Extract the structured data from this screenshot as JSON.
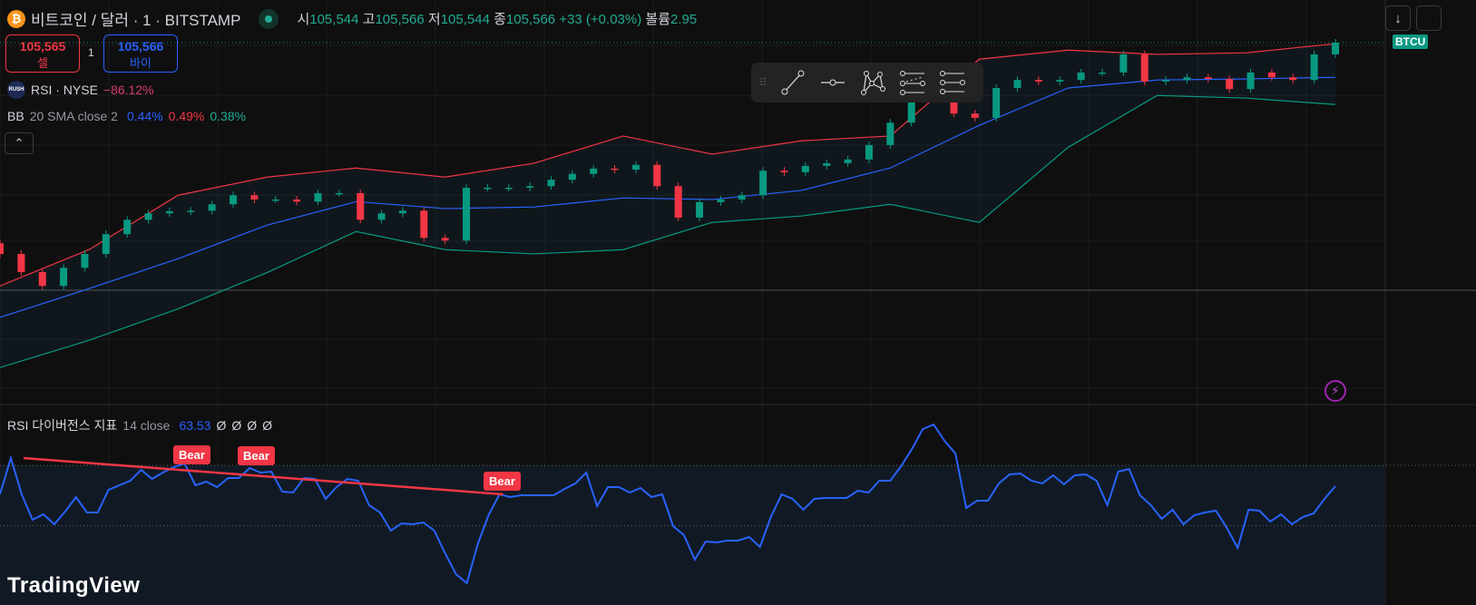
{
  "header": {
    "coin_icon": "₿",
    "symbol_title": "비트코인 / 달러 · 1 · BITSTAMP",
    "ohlc": [
      {
        "label": "시",
        "value": "105,544"
      },
      {
        "label": "고",
        "value": "105,566"
      },
      {
        "label": "저",
        "value": "105,544"
      },
      {
        "label": "종",
        "value": "105,566"
      }
    ],
    "change": "+33 (+0.03%)",
    "volume_label": "볼륨",
    "volume_value": "2.95"
  },
  "trade": {
    "sell_price": "105,565",
    "sell_label": "셀",
    "quantity": "1",
    "buy_price": "105,566",
    "buy_label": "바이"
  },
  "overlay": {
    "badge": "RUSH",
    "name": "RSI · NYSE",
    "value": "−86.12%"
  },
  "bb": {
    "name": "BB",
    "params": "20 SMA close 2",
    "mid": "0.44%",
    "upper": "0.49%",
    "lower": "0.38%"
  },
  "price_label": "BTCU",
  "rsi_pane": {
    "name": "RSI 다이버전스 지표",
    "params": "14 close",
    "value": "63.53",
    "empties": [
      "Ø",
      "Ø",
      "Ø",
      "Ø"
    ],
    "bear_label": "Bear"
  },
  "logo": "TradingView",
  "colors": {
    "up": "#089981",
    "down": "#f23645",
    "bb_upper": "#f23645",
    "bb_mid": "#2962ff",
    "bb_lower": "#089981",
    "rsi": "#2962ff"
  },
  "chart_data": [
    {
      "type": "candlestick",
      "title": "BTCUSD 1m",
      "closes": [
        105170,
        105136,
        105110,
        105144,
        105170,
        105207,
        105234,
        105246,
        105250,
        105251,
        105263,
        105280,
        105272,
        105272,
        105268,
        105284,
        105284,
        105234,
        105246,
        105251,
        105200,
        105195,
        105294,
        105294,
        105294,
        105297,
        105309,
        105320,
        105330,
        105328,
        105337,
        105297,
        105238,
        105267,
        105272,
        105280,
        105326,
        105323,
        105335,
        105340,
        105347,
        105374,
        105416,
        105462,
        105469,
        105433,
        105425,
        105481,
        105496,
        105493,
        105496,
        105510,
        105510,
        105544,
        105493,
        105496,
        105501,
        105498,
        105479,
        105510,
        105501,
        105496,
        105544,
        105566
      ],
      "bb_upper": [
        105110,
        105178,
        105280,
        105314,
        105331,
        105314,
        105340,
        105391,
        105357,
        105382,
        105391,
        105535,
        105552,
        105544,
        105547,
        105564
      ],
      "bb_mid": [
        105051,
        105105,
        105161,
        105224,
        105268,
        105255,
        105258,
        105275,
        105272,
        105289,
        105331,
        105411,
        105481,
        105496,
        105498,
        105501
      ],
      "bb_lower": [
        104957,
        105008,
        105067,
        105135,
        105212,
        105178,
        105170,
        105178,
        105229,
        105241,
        105263,
        105229,
        105370,
        105467,
        105462,
        105450
      ],
      "last_price": 105566
    },
    {
      "type": "line",
      "title": "RSI 14",
      "levels": [
        70,
        50
      ],
      "values": [
        60.4,
        72.4,
        60.4,
        52,
        53.8,
        50.5,
        54.7,
        59.5,
        54.4,
        54.4,
        61.9,
        63.4,
        64.9,
        68.5,
        65.5,
        67.6,
        69.4,
        70.6,
        63.4,
        64.6,
        62.8,
        65.8,
        65.8,
        69.1,
        67.6,
        67.9,
        61.3,
        61,
        65.8,
        65.5,
        58.9,
        62.8,
        65.5,
        64.9,
        56.8,
        54.4,
        48.4,
        50.8,
        50.5,
        51.1,
        48.4,
        40.9,
        34,
        31,
        43.9,
        53.5,
        60.4,
        59.5,
        60.1,
        60.1,
        60.1,
        60.1,
        62.2,
        64,
        67.6,
        56.5,
        62.8,
        62.8,
        61,
        62.5,
        59.5,
        60.4,
        49.9,
        46.9,
        38.8,
        44.8,
        44.5,
        45.1,
        45.1,
        46.3,
        43,
        52.9,
        60.4,
        58.9,
        55.3,
        58.9,
        59.2,
        59.2,
        59.2,
        61.6,
        61,
        64.9,
        64.9,
        69.7,
        75.4,
        82,
        83.5,
        78.1,
        73.9,
        55.9,
        58.3,
        58.3,
        64,
        67,
        67.3,
        64.9,
        64,
        66.7,
        63.7,
        66.7,
        67,
        64.9,
        56.8,
        67.9,
        68.8,
        60.1,
        56.8,
        52.3,
        55.3,
        50.5,
        53.5,
        54.4,
        55,
        49.3,
        42.7,
        55.3,
        55,
        51.4,
        53.8,
        50.5,
        52.9,
        54.1,
        58.9,
        63.1
      ],
      "divergence": {
        "from_index": 1,
        "to_index": 46,
        "bear_indices": [
          18,
          24,
          46
        ]
      }
    }
  ]
}
